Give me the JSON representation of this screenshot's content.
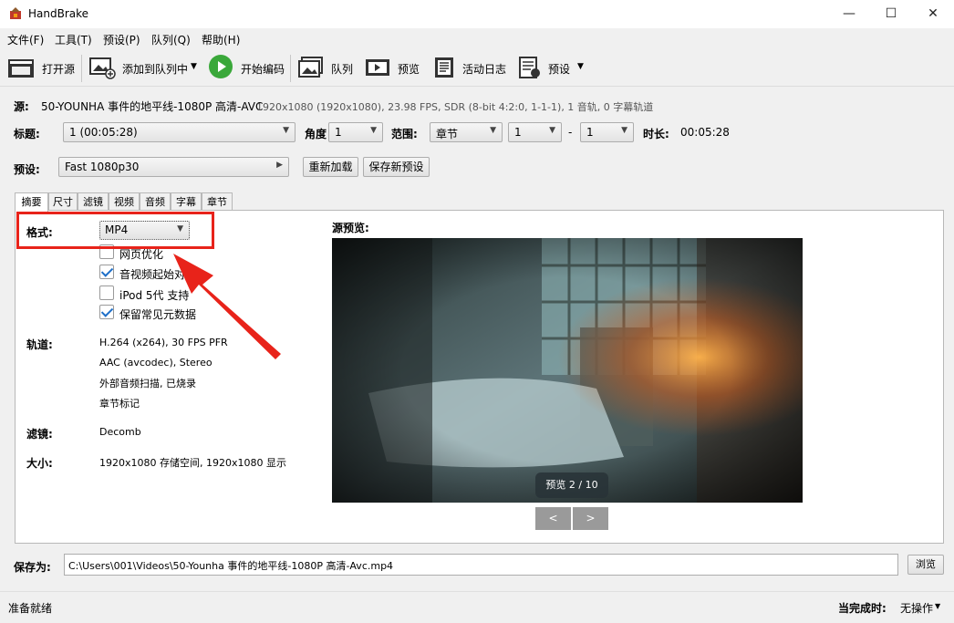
{
  "window": {
    "title": "HandBrake",
    "controls": {
      "minimize": "—",
      "maximize": "☐",
      "close": "✕"
    }
  },
  "menu": [
    "文件(F)",
    "工具(T)",
    "预设(P)",
    "队列(Q)",
    "帮助(H)"
  ],
  "toolbar": {
    "open_source": "打开源",
    "add_to_queue": "添加到队列中",
    "start_encode": "开始编码",
    "queue": "队列",
    "preview": "预览",
    "activity_log": "活动日志",
    "presets": "预设"
  },
  "source": {
    "label": "源:",
    "name": "50-YOUNHA 事件的地平线-1080P 高清-AVC",
    "details": "1920x1080 (1920x1080), 23.98 FPS, SDR (8-bit 4:2:0, 1-1-1), 1 音轨, 0 字幕轨道"
  },
  "title_row": {
    "title_label": "标题:",
    "title_value": "1 (00:05:28)",
    "angle_label": "角度",
    "angle_value": "1",
    "range_label": "范围:",
    "range_type": "章节",
    "range_start": "1",
    "range_dash": "-",
    "range_end": "1",
    "duration_label": "时长:",
    "duration_value": "00:05:28"
  },
  "preset_row": {
    "label": "预设:",
    "value": "Fast 1080p30",
    "reload": "重新加载",
    "save_new": "保存新预设"
  },
  "tabs": [
    "摘要",
    "尺寸",
    "滤镜",
    "视频",
    "音频",
    "字幕",
    "章节"
  ],
  "summary": {
    "format_label": "格式:",
    "format_value": "MP4",
    "options": [
      {
        "label": "网页优化",
        "checked": false
      },
      {
        "label": "音视频起始对齐",
        "checked": true
      },
      {
        "label": "iPod 5代 支持",
        "checked": false
      },
      {
        "label": "保留常见元数据",
        "checked": true
      }
    ],
    "tracks_label": "轨道:",
    "tracks": [
      "H.264 (x264), 30 FPS PFR",
      "AAC (avcodec), Stereo",
      "外部音频扫描, 已烧录",
      "章节标记"
    ],
    "filters_label": "滤镜:",
    "filters_value": "Decomb",
    "size_label": "大小:",
    "size_value": "1920x1080 存储空间, 1920x1080 显示"
  },
  "preview_panel": {
    "label": "源预览:",
    "badge": "预览 2 / 10",
    "prev": "<",
    "next": ">"
  },
  "save": {
    "label": "保存为:",
    "path": "C:\\Users\\001\\Videos\\50-Younha 事件的地平线-1080P 高清-Avc.mp4",
    "browse": "浏览"
  },
  "status": {
    "text": "准备就绪",
    "when_done_label": "当完成时:",
    "when_done_value": "无操作"
  },
  "colors": {
    "highlight": "#e8231a",
    "accent": "#1e6fc8"
  }
}
